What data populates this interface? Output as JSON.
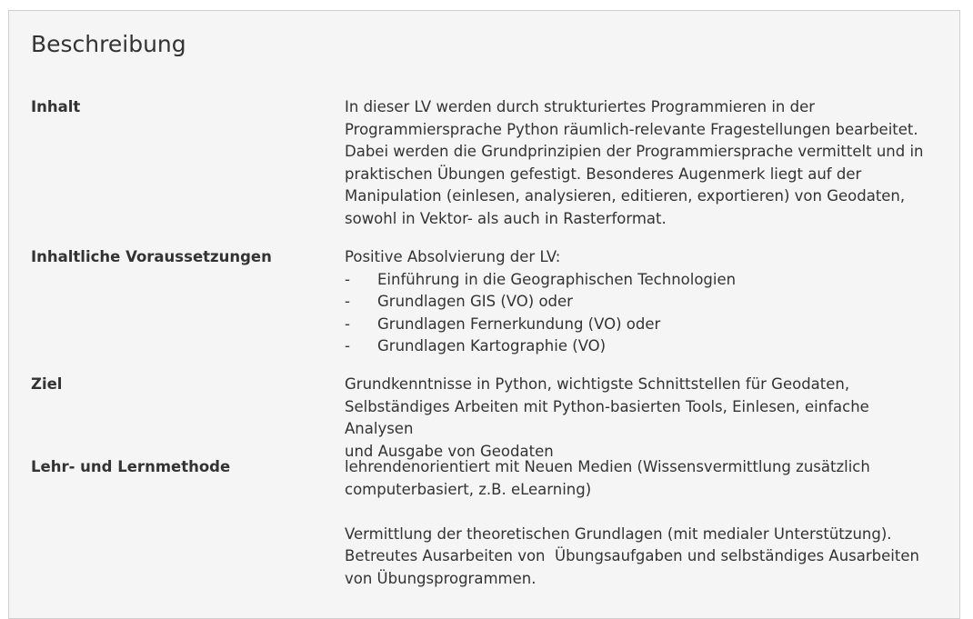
{
  "section": {
    "title": "Beschreibung"
  },
  "rows": {
    "inhalt": {
      "label": "Inhalt",
      "lines": [
        "In dieser LV werden durch strukturiertes Programmieren in der",
        "Programmiersprache Python räumlich-relevante Fragestellungen bearbeitet.",
        "Dabei werden die Grundprinzipien der Programmiersprache vermittelt und in",
        "praktischen Übungen gefestigt. Besonderes Augenmerk liegt auf der",
        "Manipulation (einlesen, analysieren, editieren, exportieren) von Geodaten,",
        "sowohl in Vektor- als auch in Rasterformat."
      ]
    },
    "voraussetzungen": {
      "label": "Inhaltliche Voraussetzungen",
      "intro": "Positive Absolvierung der LV:",
      "bullet_marker": "-",
      "items": [
        "Einführung in die Geographischen Technologien",
        "Grundlagen GIS (VO) oder",
        "Grundlagen Fernerkundung (VO) oder",
        "Grundlagen Kartographie (VO)"
      ]
    },
    "ziel": {
      "label": "Ziel",
      "lines": [
        "Grundkenntnisse in Python, wichtigste Schnittstellen für Geodaten,",
        "Selbständiges Arbeiten mit Python-basierten Tools, Einlesen, einfache Analysen",
        "und Ausgabe von Geodaten"
      ]
    },
    "lehrmethode": {
      "label": "Lehr- und Lernmethode",
      "para1": [
        "lehrendenorientiert mit Neuen Medien (Wissensvermittlung zusätzlich",
        "computerbasiert, z.B. eLearning)"
      ],
      "para2": [
        "Vermittlung der theoretischen Grundlagen (mit medialer Unterstützung).",
        "Betreutes Ausarbeiten von  Übungsaufgaben und selbständiges Ausarbeiten",
        "von Übungsprogrammen."
      ]
    }
  }
}
